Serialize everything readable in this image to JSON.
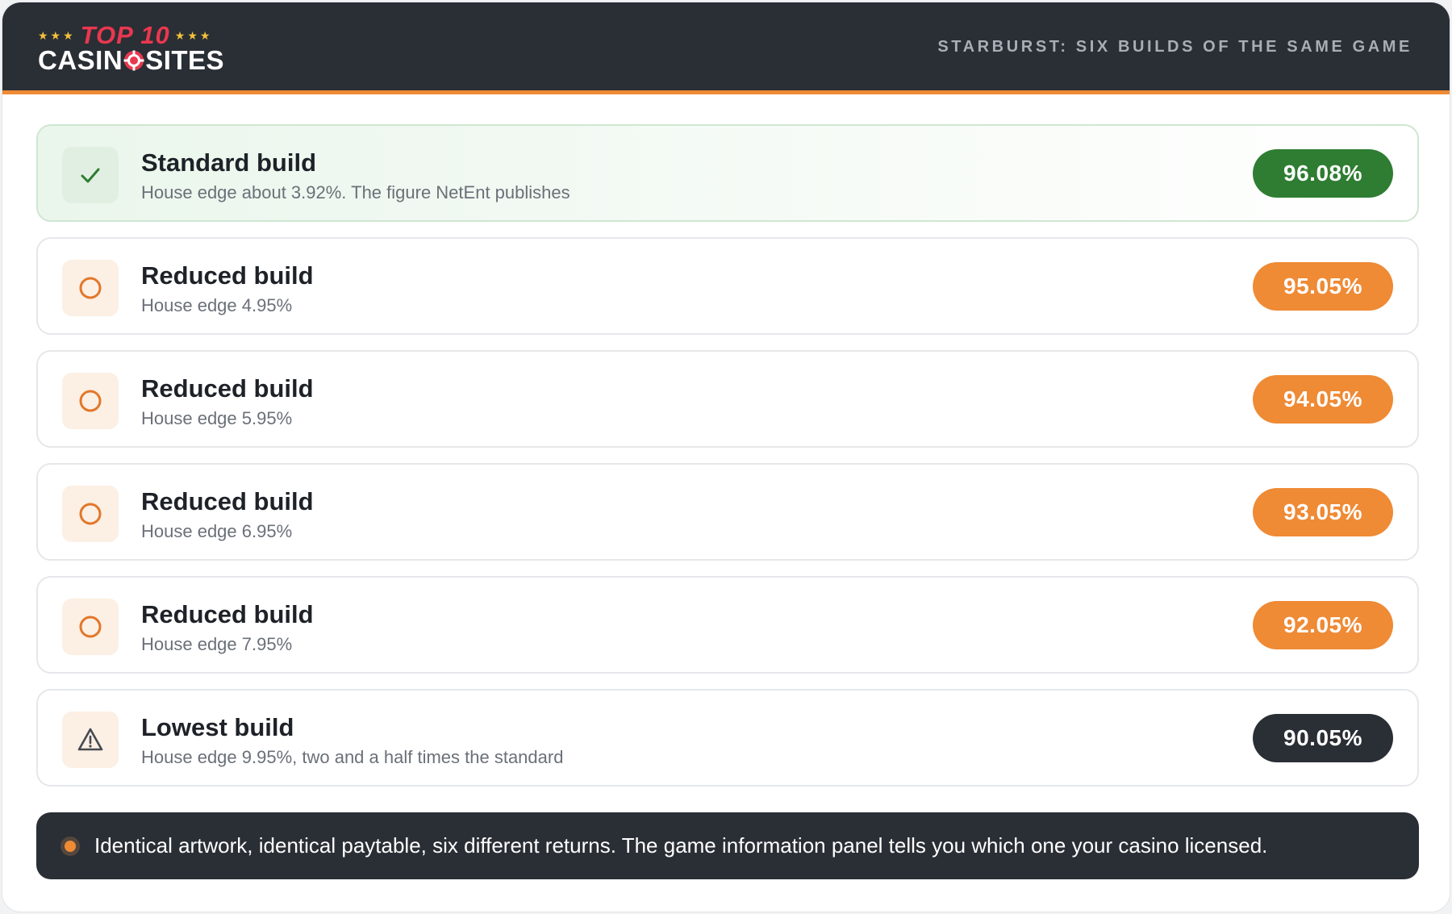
{
  "colors": {
    "header_bg": "#2a2e35",
    "accent_orange": "#ef8a35",
    "standard_green": "#2e7d32",
    "lowest_dark": "#2a2e35"
  },
  "header": {
    "logo": {
      "top": "TOP 10",
      "bottom_left": "CASIN",
      "bottom_right": "SITES",
      "stars": "★★★"
    },
    "title": "STARBURST: SIX BUILDS OF THE SAME GAME"
  },
  "builds": [
    {
      "title": "Standard build",
      "subtitle": "House edge about 3.92%. The figure NetEnt publishes",
      "rtp": "96.08%",
      "icon": "check-icon",
      "status": "standard",
      "pill_color": "#2e7d32"
    },
    {
      "title": "Reduced build",
      "subtitle": "House edge 4.95%",
      "rtp": "95.05%",
      "icon": "circle-icon",
      "status": "reduced",
      "pill_color": "#ef8a35"
    },
    {
      "title": "Reduced build",
      "subtitle": "House edge 5.95%",
      "rtp": "94.05%",
      "icon": "circle-icon",
      "status": "reduced",
      "pill_color": "#ef8a35"
    },
    {
      "title": "Reduced build",
      "subtitle": "House edge 6.95%",
      "rtp": "93.05%",
      "icon": "circle-icon",
      "status": "reduced",
      "pill_color": "#ef8a35"
    },
    {
      "title": "Reduced build",
      "subtitle": "House edge 7.95%",
      "rtp": "92.05%",
      "icon": "circle-icon",
      "status": "reduced",
      "pill_color": "#ef8a35"
    },
    {
      "title": "Lowest build",
      "subtitle": "House edge 9.95%, two and a half times the standard",
      "rtp": "90.05%",
      "icon": "warning-icon",
      "status": "lowest",
      "pill_color": "#2a2e35"
    }
  ],
  "footer": {
    "note": "Identical artwork, identical paytable, six different returns. The game information panel tells you which one your casino licensed."
  }
}
